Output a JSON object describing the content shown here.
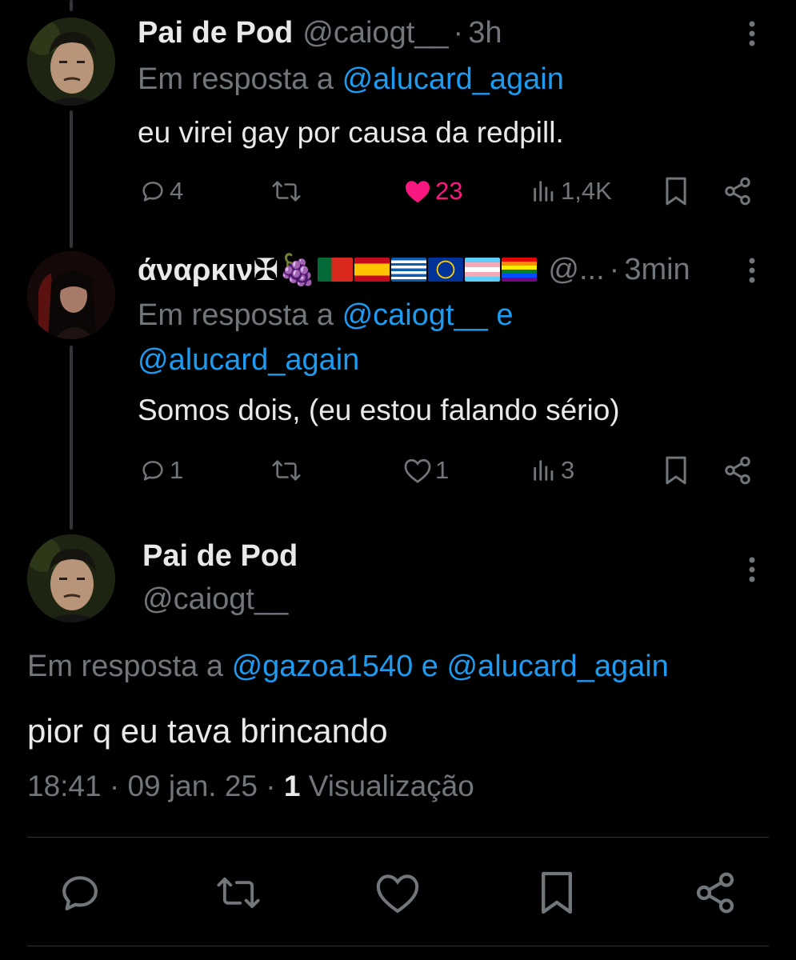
{
  "replies": [
    {
      "name": "Pai de Pod",
      "handle": "@caiogt__",
      "separator": "·",
      "time": "3h",
      "reply_prefix": "Em resposta a",
      "reply_mention_1": "@alucard_again",
      "text": "eu virei gay por causa da redpill.",
      "stats": {
        "replies": "4",
        "likes": "23",
        "views": "1,4K"
      },
      "liked": true
    },
    {
      "name": "άναρκιν✠🍇",
      "handle": "@...",
      "separator": "·",
      "time": "3min",
      "reply_prefix": "Em resposta a",
      "reply_mention_1": "@caiogt__",
      "reply_joiner": "e",
      "reply_mention_2": "@alucard_again",
      "text": "Somos dois, (eu estou falando sério)",
      "stats": {
        "replies": "1",
        "likes": "1",
        "views": "3"
      },
      "liked": false
    }
  ],
  "main_post": {
    "name": "Pai de Pod",
    "handle": "@caiogt__",
    "reply_prefix": "Em resposta a",
    "reply_mention_1": "@gazoa1540",
    "reply_joiner": "e",
    "reply_mention_2": "@alucard_again",
    "text": "pior q eu tava brincando",
    "time": "18:41",
    "date": "09 jan. 25",
    "views_count": "1",
    "views_label": "Visualização",
    "separator": "·"
  },
  "colors": {
    "background": "#000000",
    "text": "#e7e9ea",
    "muted": "#71767b",
    "link": "#1d9bf0",
    "like": "#f91880"
  },
  "icons": [
    "reply-icon",
    "retweet-icon",
    "heart-icon",
    "views-icon",
    "bookmark-icon",
    "share-icon",
    "more-icon"
  ]
}
